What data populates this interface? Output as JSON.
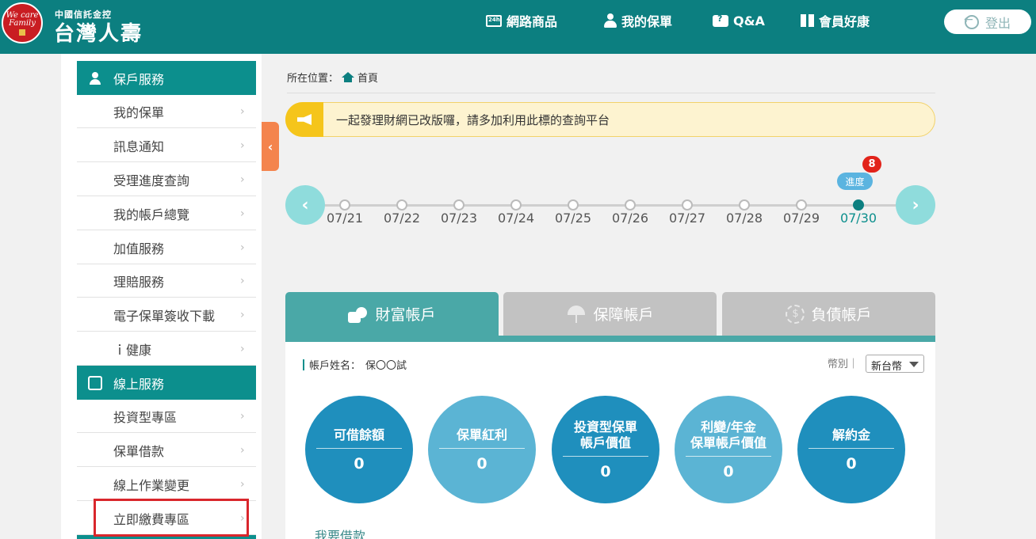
{
  "header": {
    "brand_sub": "中國信託金控",
    "brand_main": "台灣人壽",
    "logo_text": "We care Family",
    "nav": [
      {
        "label": "網路商品",
        "icon": "24h-box-icon"
      },
      {
        "label": "我的保單",
        "icon": "person-icon"
      },
      {
        "label": "Q&A",
        "icon": "chat-question-icon"
      },
      {
        "label": "會員好康",
        "icon": "gift-icon"
      }
    ],
    "logout_label": "登出"
  },
  "sidebar": {
    "sections": [
      {
        "title": "保戶服務",
        "icon": "person-icon",
        "items": [
          "我的保單",
          "訊息通知",
          "受理進度查詢",
          "我的帳戶總覽",
          "加值服務",
          "理賠服務",
          "電子保單簽收下載",
          "ｉ健康"
        ]
      },
      {
        "title": "線上服務",
        "icon": "monitor-icon",
        "items": [
          "投資型專區",
          "保單借款",
          "線上作業變更",
          "立即繳費專區"
        ]
      }
    ],
    "collapse_glyph": "‹",
    "chevron": "›"
  },
  "breadcrumb": {
    "prefix": "所在位置：",
    "home": "首頁"
  },
  "announcement": {
    "text": "一起發理財網已改版囉，請多加利用此標的查詢平台"
  },
  "timeline": {
    "dates": [
      "07/21",
      "07/22",
      "07/23",
      "07/24",
      "07/25",
      "07/26",
      "07/27",
      "07/28",
      "07/29",
      "07/30"
    ],
    "active_index": 9,
    "progress_label": "進度",
    "badge_count": "8",
    "prev_glyph": "‹",
    "next_glyph": "›"
  },
  "tabs": [
    {
      "label": "財富帳戶",
      "active": true,
      "icon": "coins-icon"
    },
    {
      "label": "保障帳戶",
      "active": false,
      "icon": "umbrella-icon"
    },
    {
      "label": "負債帳戶",
      "active": false,
      "icon": "dollar-icon"
    }
  ],
  "account": {
    "name_label": "帳戶姓名：",
    "name_value": "保〇〇試",
    "currency_label": "幣別｜",
    "currency_value": "新台幣"
  },
  "summary": [
    {
      "label": "可借餘額",
      "value": "0",
      "tone": "dark"
    },
    {
      "label": "保單紅利",
      "value": "0",
      "tone": "light"
    },
    {
      "label": "投資型保單\n帳戶價值",
      "value": "0",
      "tone": "dark"
    },
    {
      "label": "利變/年金\n保單帳戶價值",
      "value": "0",
      "tone": "light"
    },
    {
      "label": "解約金",
      "value": "0",
      "tone": "dark"
    }
  ],
  "loan_link": "我要借款",
  "colors": {
    "header": "#0c7f80",
    "section_head": "#0c8f8d",
    "active_tab": "#4aa8a7",
    "highlight": "#d9262c"
  }
}
